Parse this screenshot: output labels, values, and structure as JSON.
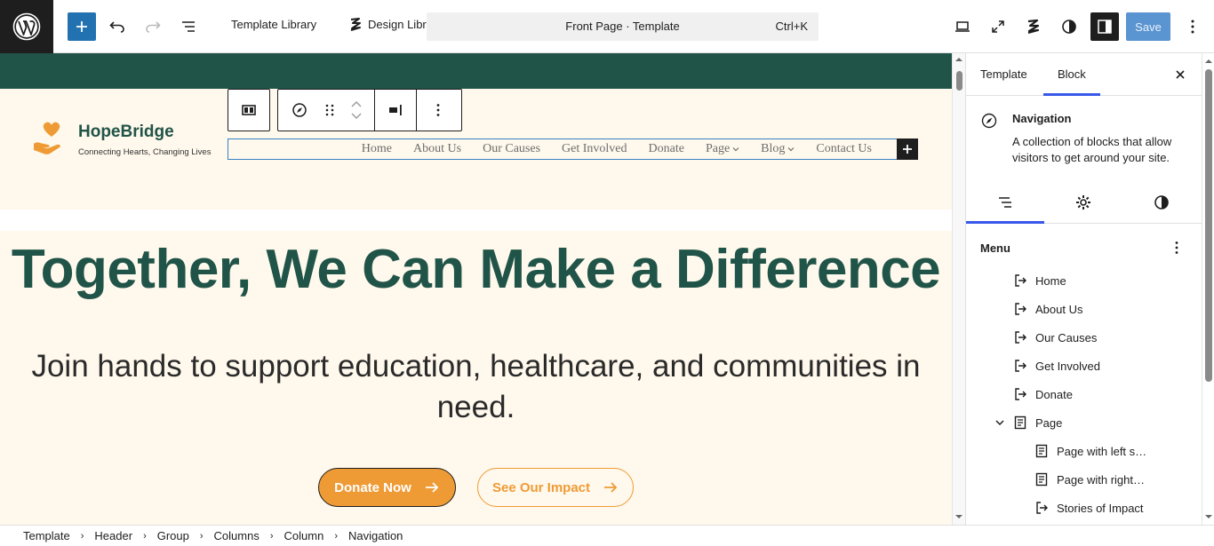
{
  "toolbar": {
    "template_library": "Template Library",
    "design_library": "Design Library",
    "command_title": "Front Page · Template",
    "command_shortcut": "Ctrl+K",
    "save_label": "Save"
  },
  "site": {
    "logo_name": "HopeBridge",
    "logo_tagline": "Connecting Hearts, Changing Lives",
    "nav": [
      "Home",
      "About Us",
      "Our Causes",
      "Get Involved",
      "Donate",
      "Page",
      "Blog",
      "Contact Us"
    ]
  },
  "hero": {
    "title": "Together, We Can Make a Difference",
    "subtitle": "Join hands to support education, healthcare, and communities in need.",
    "primary_button": "Donate Now",
    "secondary_button": "See Our Impact"
  },
  "sidebar": {
    "tab_template": "Template",
    "tab_block": "Block",
    "block_title": "Navigation",
    "block_description": "A collection of blocks that allow visitors to get around your site.",
    "menu_label": "Menu",
    "menu_items": [
      {
        "label": "Home",
        "type": "link"
      },
      {
        "label": "About Us",
        "type": "link"
      },
      {
        "label": "Our Causes",
        "type": "link"
      },
      {
        "label": "Get Involved",
        "type": "link"
      },
      {
        "label": "Donate",
        "type": "link"
      },
      {
        "label": "Page",
        "type": "submenu"
      },
      {
        "label": "Page with left s…",
        "type": "page"
      },
      {
        "label": "Page with right…",
        "type": "page"
      },
      {
        "label": "Stories of Impact",
        "type": "link"
      }
    ]
  },
  "breadcrumb": [
    "Template",
    "Header",
    "Group",
    "Columns",
    "Column",
    "Navigation"
  ],
  "colors": {
    "brand_green": "#215448",
    "accent_orange": "#ee9b35",
    "cream": "#fff8ec",
    "wp_blue": "#2271b1",
    "selection_blue": "#3582c4"
  }
}
